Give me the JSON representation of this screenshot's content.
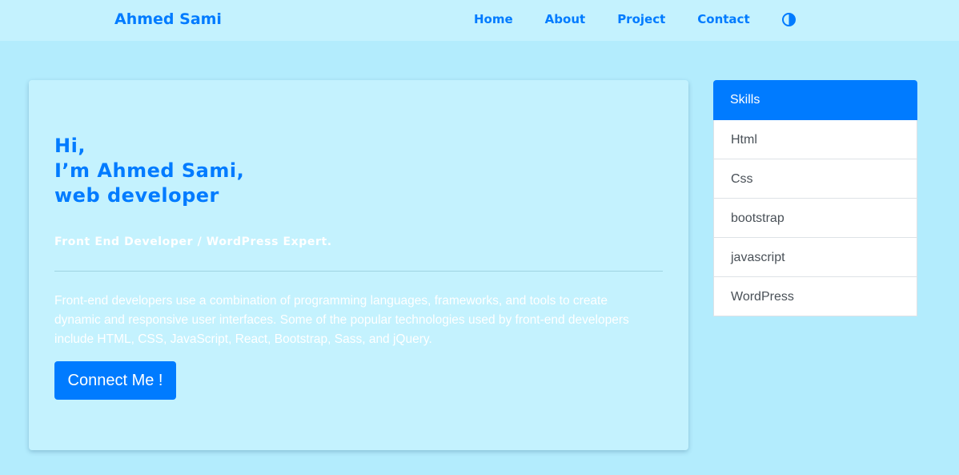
{
  "navbar": {
    "brand": "Ahmed Sami",
    "links": [
      "Home",
      "About",
      "Project",
      "Contact"
    ],
    "theme_icon": "half-circle-contrast-icon"
  },
  "hero": {
    "greeting": "Hi,",
    "intro": "I’m Ahmed Sami,",
    "role": "web developer",
    "subtitle": "Front End Developer / WordPress Expert.",
    "description": "Front-end developers use a combination of programming languages, frameworks, and tools to create dynamic and responsive user interfaces. Some of the popular technologies used by front-end developers include HTML, CSS, JavaScript, React, Bootstrap, Sass, and jQuery.",
    "button_label": "Connect Me !"
  },
  "skills": {
    "header": "Skills",
    "items": [
      "Html",
      "Css",
      "bootstrap",
      "javascript",
      "WordPress"
    ]
  },
  "colors": {
    "page_background": "#b3ecfd",
    "card_background": "#c4f2fe",
    "accent": "#007bff"
  }
}
